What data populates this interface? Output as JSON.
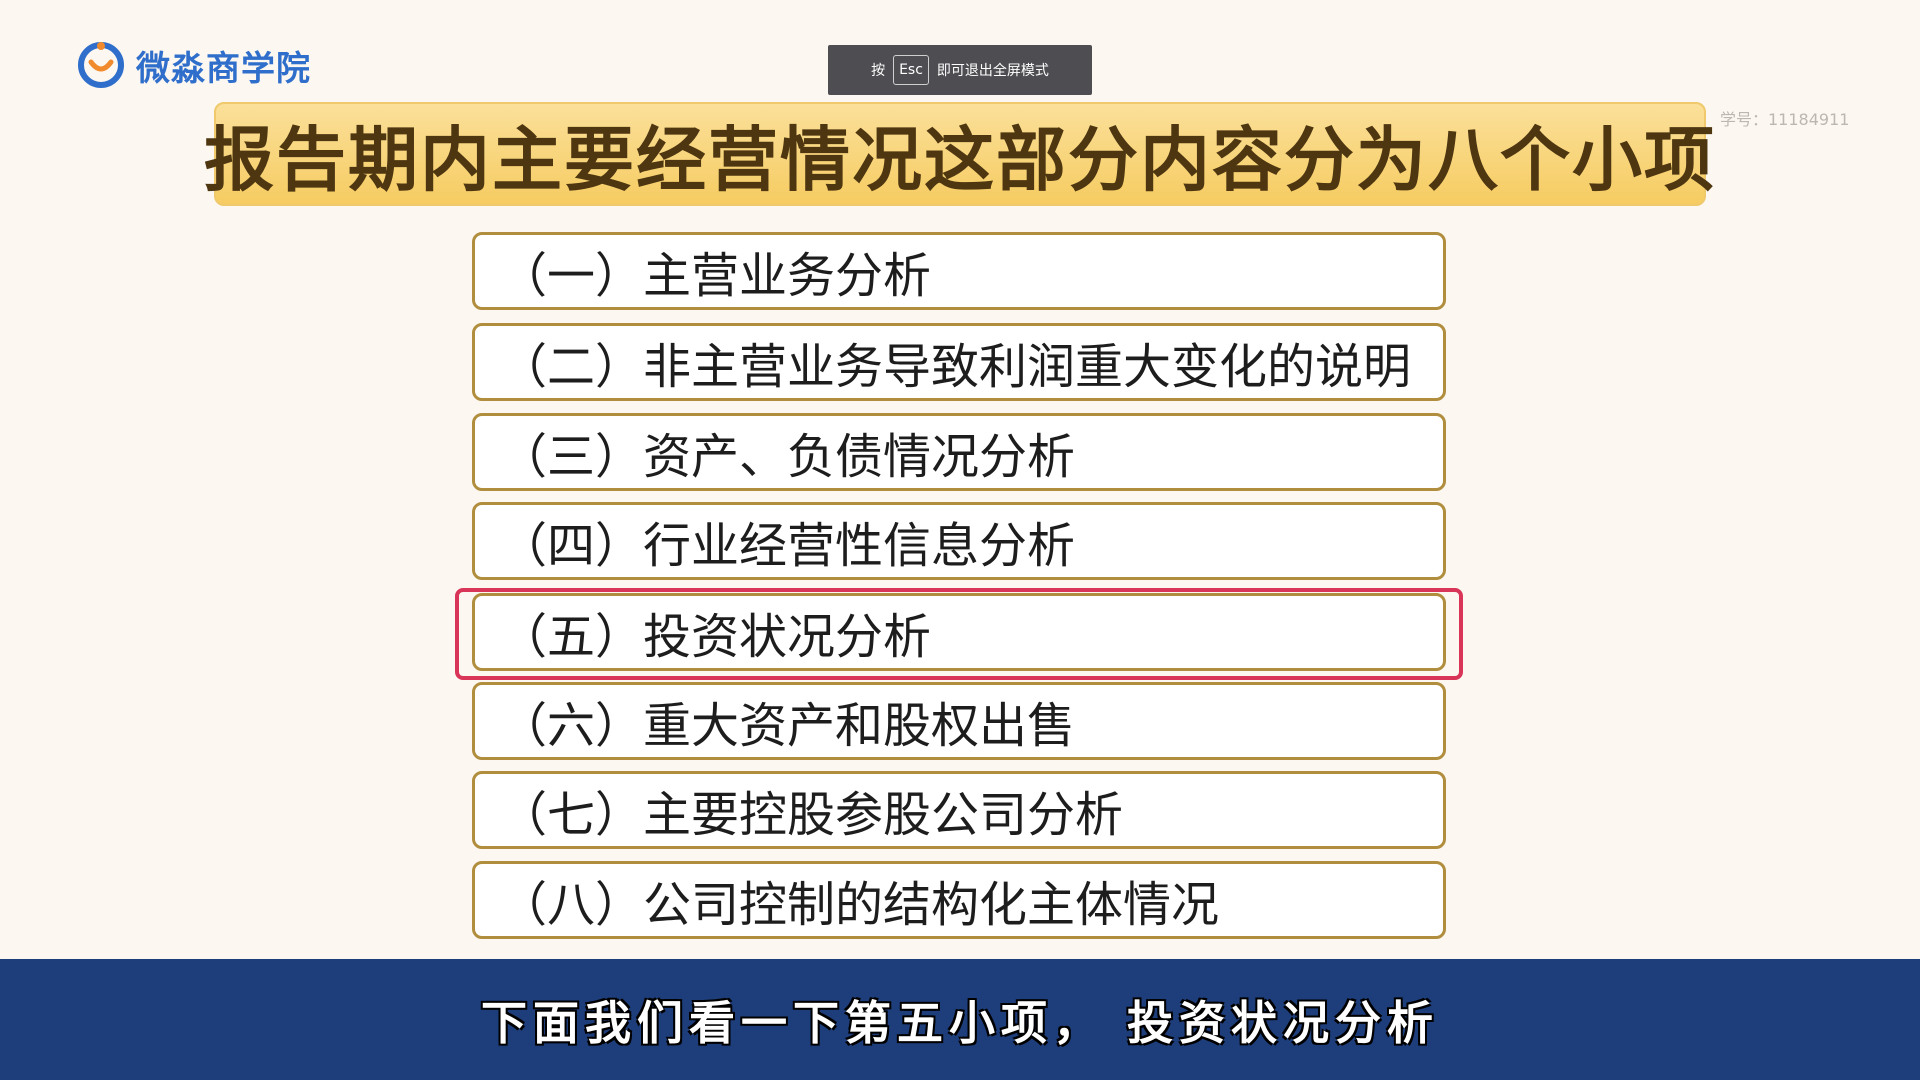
{
  "logo": {
    "text": "微淼商学院",
    "icon": "logo-mark-icon",
    "colors": {
      "text": "#2f6fcb",
      "ring": "#2f6fcb",
      "accent": "#f08a2c"
    }
  },
  "fullscreen_toast": {
    "prefix": "按",
    "key": "Esc",
    "suffix": "即可退出全屏模式"
  },
  "student_id": "学号：11184911",
  "slide": {
    "title": "报告期内主要经营情况这部分内容分为八个小项",
    "items": [
      {
        "label": "（一）主营业务分析"
      },
      {
        "label": "（二）非主营业务导致利润重大变化的说明"
      },
      {
        "label": "（三）资产、负债情况分析"
      },
      {
        "label": "（四）行业经营性信息分析"
      },
      {
        "label": "（五）投资状况分析",
        "highlighted": true
      },
      {
        "label": "（六）重大资产和股权出售"
      },
      {
        "label": "（七）主要控股参股公司分析"
      },
      {
        "label": "（八）公司控制的结构化主体情况"
      }
    ],
    "colors": {
      "title_bg": "#f8d574",
      "item_border": "#b08e3d",
      "highlight": "#d83558"
    }
  },
  "subtitle": {
    "text": "下面我们看一下第五小项，  投资状况分析",
    "bar_color": "#1e3e7b"
  }
}
